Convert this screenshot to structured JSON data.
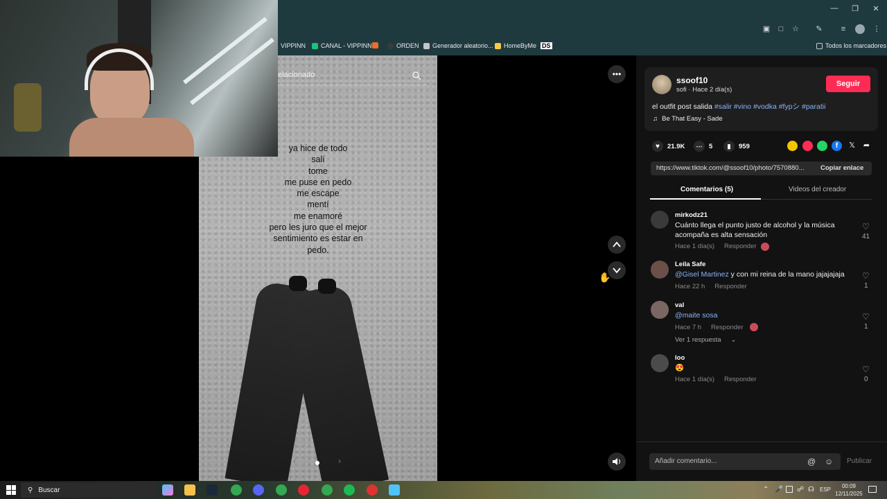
{
  "browser": {
    "bookmarks": [
      {
        "label": "VIPPINN",
        "color": "#2b2b2b"
      },
      {
        "label": "CANAL - VIPPINN",
        "color": "#19c37d"
      },
      {
        "label": "",
        "color": "#e66f2b"
      },
      {
        "label": "ORDEN",
        "color": "#3b3b3b"
      },
      {
        "label": "Generador aleatorio...",
        "color": "#c5c5c5"
      },
      {
        "label": "HomeByMe",
        "color": "#f7c948"
      },
      {
        "label": "DS",
        "color": "#ffffff"
      }
    ],
    "all_bookmarks_label": "Todos los marcadores"
  },
  "video": {
    "search_placeholder": "elacionado",
    "poem_lines": [
      "ya hice de todo",
      "salí",
      "tome",
      "me puse en pedo",
      "me escape",
      "mentí",
      "me enamoré",
      "pero les juro que el mejor",
      "sentimiento es estar en",
      "pedo."
    ]
  },
  "post": {
    "username": "ssoof10",
    "subtitle": "sofi · Hace 2 día(s)",
    "follow_label": "Seguir",
    "caption_text": "el outfit post salida",
    "hashtags": [
      "#salir",
      "#vino",
      "#vodka",
      "#fypシ",
      "#paratii"
    ],
    "music": "Be That Easy - Sade",
    "likes": "21.9K",
    "comments_count": "5",
    "saves": "959",
    "link": "https://www.tiktok.com/@ssoof10/photo/7570880...",
    "copy_link_label": "Copiar enlace",
    "tab_comments": "Comentarios (5)",
    "tab_videos": "Videos del creador"
  },
  "comments": [
    {
      "user": "mirkodz21",
      "text": "Cuánto llega el punto justo de alcohol y la música acompaña es alta sensación",
      "time": "Hace 1 día(s)",
      "reply": "Responder",
      "likes": "41",
      "avatar_color": "#3a3a3a"
    },
    {
      "user": "Leila Safe",
      "mention": "@Gisel Martinez",
      "text": " y con mi reina de la mano jajajajaja",
      "time": "Hace 22 h",
      "reply": "Responder",
      "likes": "1",
      "avatar_color": "#6b4f49"
    },
    {
      "user": "val",
      "mention": "@maite sosa",
      "text": "",
      "time": "Hace 7 h",
      "reply": "Responder",
      "likes": "1",
      "avatar_color": "#7a6663",
      "more_replies": "Ver 1 respuesta"
    },
    {
      "user": "loo",
      "text": "😍",
      "time": "Hace 1 día(s)",
      "reply": "Responder",
      "likes": "0",
      "avatar_color": "#4b4b4b"
    }
  ],
  "composer": {
    "placeholder": "Añadir comentario...",
    "post_label": "Publicar"
  },
  "taskbar": {
    "search_label": "Buscar",
    "lang": "ESP",
    "time": "00:09",
    "date": "12/11/2025"
  }
}
